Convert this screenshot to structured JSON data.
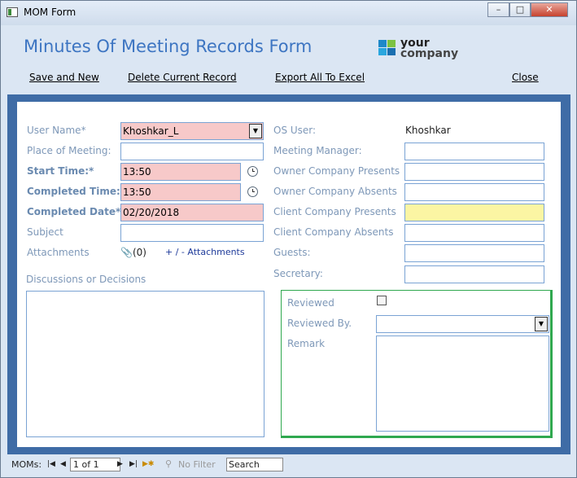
{
  "window": {
    "title": "MOM Form",
    "controls": {
      "minimize": "–",
      "maximize": "□",
      "close": "✕"
    }
  },
  "header": {
    "title": "Minutes Of Meeting Records Form",
    "logo": {
      "line1": "your",
      "line2": "company"
    },
    "commands": {
      "save_new": "Save and New",
      "delete": "Delete Current Record",
      "export": "Export All To Excel",
      "close": "Close"
    }
  },
  "left": {
    "user_name": {
      "label": "User Name*",
      "value": "Khoshkar_L"
    },
    "place": {
      "label": "Place of Meeting:",
      "value": ""
    },
    "start_time": {
      "label": "Start Time:*",
      "value": "13:50"
    },
    "completed_time": {
      "label": "Completed Time:*",
      "value": "13:50"
    },
    "completed_date": {
      "label": "Completed Date*",
      "value": "02/20/2018"
    },
    "subject": {
      "label": "Subject",
      "value": ""
    },
    "attachments": {
      "label": "Attachments",
      "count": "(0)",
      "link": "+ / -  Attachments"
    },
    "discussions": {
      "label": "Discussions or Decisions",
      "value": ""
    }
  },
  "right": {
    "os_user": {
      "label": "OS User:",
      "value": "Khoshkar"
    },
    "meeting_manager": {
      "label": "Meeting Manager:",
      "value": ""
    },
    "owner_presents": {
      "label": "Owner Company Presents",
      "value": ""
    },
    "owner_absents": {
      "label": "Owner Company Absents",
      "value": ""
    },
    "client_presents": {
      "label": "Client Company Presents",
      "value": ""
    },
    "client_absents": {
      "label": "Client Company Absents",
      "value": ""
    },
    "guests": {
      "label": "Guests:",
      "value": ""
    },
    "secretary": {
      "label": "Secretary:",
      "value": ""
    }
  },
  "review": {
    "reviewed": {
      "label": "Reviewed",
      "checked": false
    },
    "reviewed_by": {
      "label": "Reviewed By.",
      "value": ""
    },
    "remark": {
      "label": "Remark",
      "value": ""
    }
  },
  "statusbar": {
    "label": "MOMs:",
    "record": "1 of 1",
    "filter": "No Filter",
    "search": "Search"
  },
  "colors": {
    "accent": "#3d75c2",
    "frame": "#3f6ca6",
    "required_bg": "#f7c9c9",
    "highlight_bg": "#fbf5a3",
    "review_border": "#2fa84f"
  }
}
